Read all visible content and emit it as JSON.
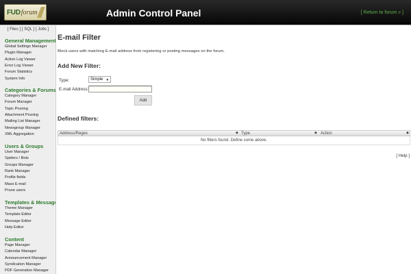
{
  "header": {
    "logo_fud": "FUD",
    "logo_forum": "forum",
    "title": "Admin Control Panel",
    "return_link": "[ Return to forum » ]"
  },
  "sidebar": {
    "top_links": [
      "Files",
      "SQL",
      "Jobs"
    ],
    "sections": [
      {
        "heading": "General Management",
        "items": [
          "Global Settings Manager",
          "Plugin Manager",
          "Action Log Viewer",
          "Error Log Viewer",
          "Forum Statistics",
          "System Info"
        ]
      },
      {
        "heading": "Categories & Forums",
        "items": [
          "Category Manager",
          "Forum Manager",
          "Topic Pruning",
          "Attachment Pruning",
          "Mailing List Manager",
          "Newsgroup Manager",
          "XML Aggregation"
        ]
      },
      {
        "heading": "Users & Groups",
        "items": [
          "User Manager",
          "Spiders / Bots",
          "Groups Manager",
          "Rank Manager",
          "Profile fields",
          "Mass E-mail",
          "Prune users"
        ]
      },
      {
        "heading": "Templates & Messages",
        "items": [
          "Theme Manager",
          "Template Editor",
          "Message Editor",
          "Help Editor"
        ]
      },
      {
        "heading": "Content",
        "items": [
          "Page Manager",
          "Calendar Manager",
          "Announcement Manager",
          "Syndication Manager",
          "PDF Generation Manager"
        ]
      }
    ]
  },
  "main": {
    "title": "E-mail Filter",
    "description": "Block users with matching E-mail address from registering or posting messages on the forum.",
    "add_section_title": "Add New Filter:",
    "type_label": "Type:",
    "type_value": "Simple",
    "email_label": "E-mail Address:",
    "email_value": "",
    "add_button": "Add",
    "defined_title": "Defined filters:",
    "table": {
      "columns": [
        "Address/Regex",
        "Type",
        "Action"
      ],
      "empty_message": "No filters found. Define some above."
    },
    "help_link": "[ Help ]"
  }
}
